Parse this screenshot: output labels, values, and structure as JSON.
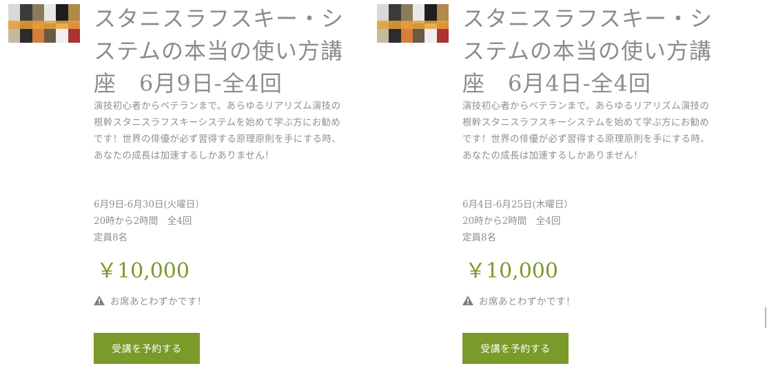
{
  "cards": [
    {
      "title": "スタニスラフスキー・システムの本当の使い方講座　6月9日-全4回",
      "description": "演技初心者からベテランまで。あらゆるリアリズム演技の根幹スタニスラフスキーシステムを始めて学ぶ方にお勧めです！世界の俳優が必ず習得する原理原則を手にする時、あなたの成長は加速するしかありません！",
      "schedule": {
        "dates": "6月9日-6月30日(火曜日）",
        "time": "20時から2時間　全4回",
        "capacity": "定員8名"
      },
      "price": "￥10,000",
      "notice": "お席あとわずかです！",
      "button_label": "受講を予約する"
    },
    {
      "title": "スタニスラフスキー・システムの本当の使い方講座　6月4日-全4回",
      "description": "演技初心者からベテランまで。あらゆるリアリズム演技の根幹スタニスラフスキーシステムを始めて学ぶ方にお勧めです！世界の俳優が必ず習得する原理原則を手にする時、あなたの成長は加速するしかありません！",
      "schedule": {
        "dates": "6月4日-6月25日(木曜日）",
        "time": "20時から2時間　全4回",
        "capacity": "定員8名"
      },
      "price": "￥10,000",
      "notice": "お席あとわずかです！",
      "button_label": "受講を予約する"
    }
  ],
  "icons": {
    "notice_icon": "warning-icon"
  },
  "colors": {
    "accent": "#7a9a2a",
    "text": "#8f8f8f",
    "title": "#8c8c8c"
  }
}
